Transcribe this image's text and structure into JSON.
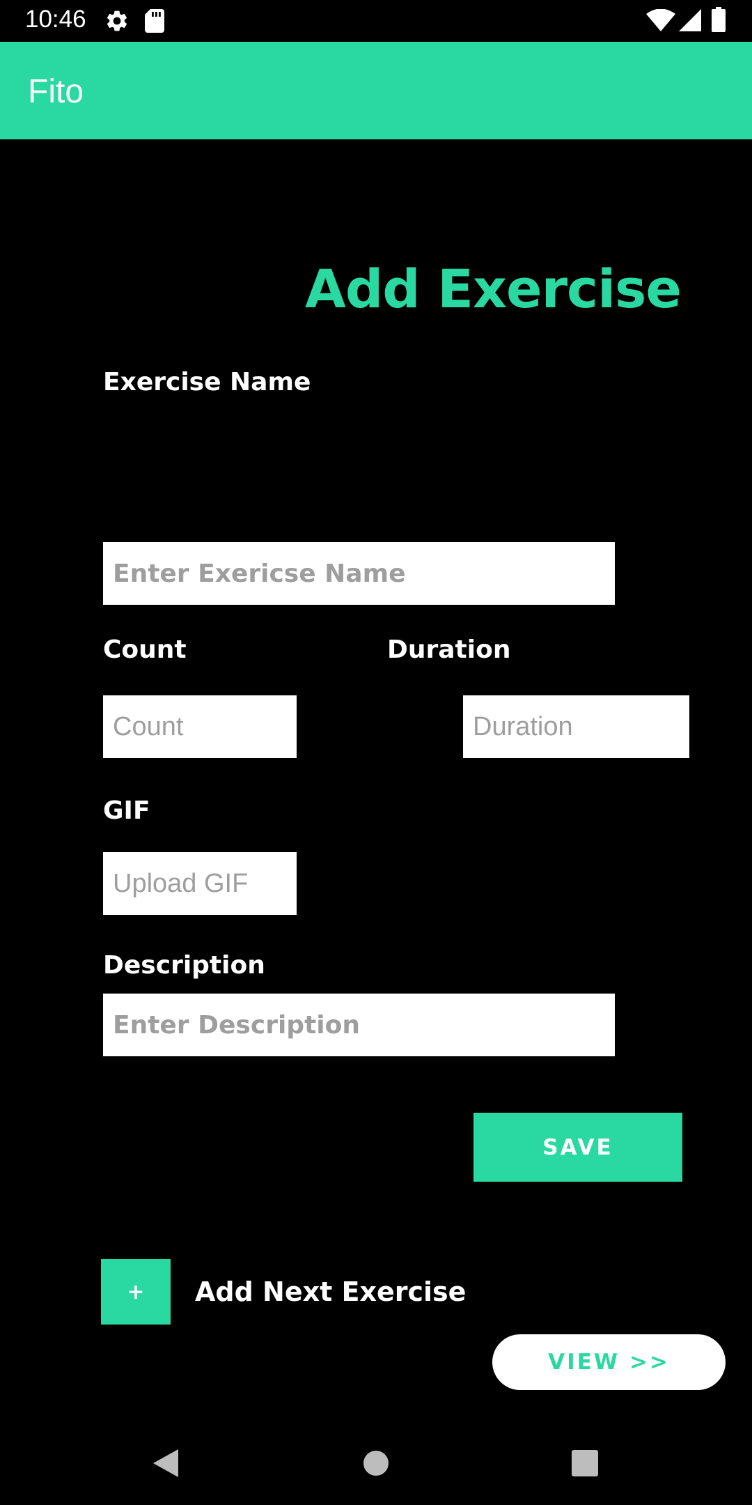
{
  "status_bar": {
    "time": "10:46",
    "icons": [
      "gear-icon",
      "sd-card-icon",
      "wifi-icon",
      "signal-icon",
      "battery-icon"
    ]
  },
  "app_bar": {
    "title": "Fito",
    "color": "#2ad8a2"
  },
  "form": {
    "heading": "Add Exercise",
    "exercise_name": {
      "label": "Exercise Name",
      "value": "",
      "placeholder": "Enter Exericse Name"
    },
    "count": {
      "label": "Count",
      "value": "",
      "placeholder": "Count"
    },
    "duration": {
      "label": "Duration",
      "value": "",
      "placeholder": "Duration"
    },
    "gif": {
      "label": "GIF",
      "value": "",
      "placeholder": "Upload GIF"
    },
    "description": {
      "label": "Description",
      "value": "",
      "placeholder": "Enter Description"
    },
    "save_label": "SAVE"
  },
  "add_next": {
    "button_label": "+",
    "label": "Add Next Exercise"
  },
  "view_button": {
    "label": "VIEW >>"
  },
  "nav_bar": {
    "icons": [
      "back-icon",
      "home-icon",
      "recents-icon"
    ]
  }
}
